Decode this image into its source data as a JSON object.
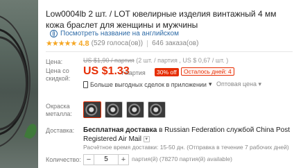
{
  "product": {
    "title": "Low0004lb 2 шт. / LOT ювелирные изделия винтажный 4 мм кожа браслет для женщины и мужчины",
    "translate_link": "Посмотреть название на английском",
    "rating": {
      "stars": "★★★★★",
      "value": "4.8",
      "votes": "(529 голоса(ов))",
      "orders": "646 заказа(ов)"
    }
  },
  "price": {
    "label": "Цена:",
    "old_price": "US $1,90 / партия",
    "old_detail": "(2 шт. / партия , US $ 0,67 / шт. )",
    "discount_label": "Цена со скидкой:",
    "new_price": "US $1.33",
    "per_unit": "/ партия",
    "off_badge": "30% off",
    "days_left": "Осталось дней: 4",
    "deals_text": "Больше выгодных сделок в приложении",
    "deals_caret": "▾",
    "wholesale": "Оптовая цена",
    "wholesale_caret": "▾"
  },
  "color": {
    "label": "Окраска металла:"
  },
  "delivery": {
    "label": "Доставка:",
    "free": "Бесплатная доставка",
    "to": "в Russian Federation службой",
    "carrier": "China Post Registered Air Mail",
    "caret": "▾",
    "time": "Расчётное время доставки: 15-50 дн. (Отправка в течение 7 рабочих дней)"
  },
  "quantity": {
    "label": "Количество:",
    "minus": "−",
    "value": "5",
    "plus": "+",
    "available": "партия(й) (78270 партия(й) available)"
  },
  "colors": {
    "price_red": "#e62e04",
    "link_blue": "#2d6aa6",
    "star_gold": "#f5a623"
  }
}
